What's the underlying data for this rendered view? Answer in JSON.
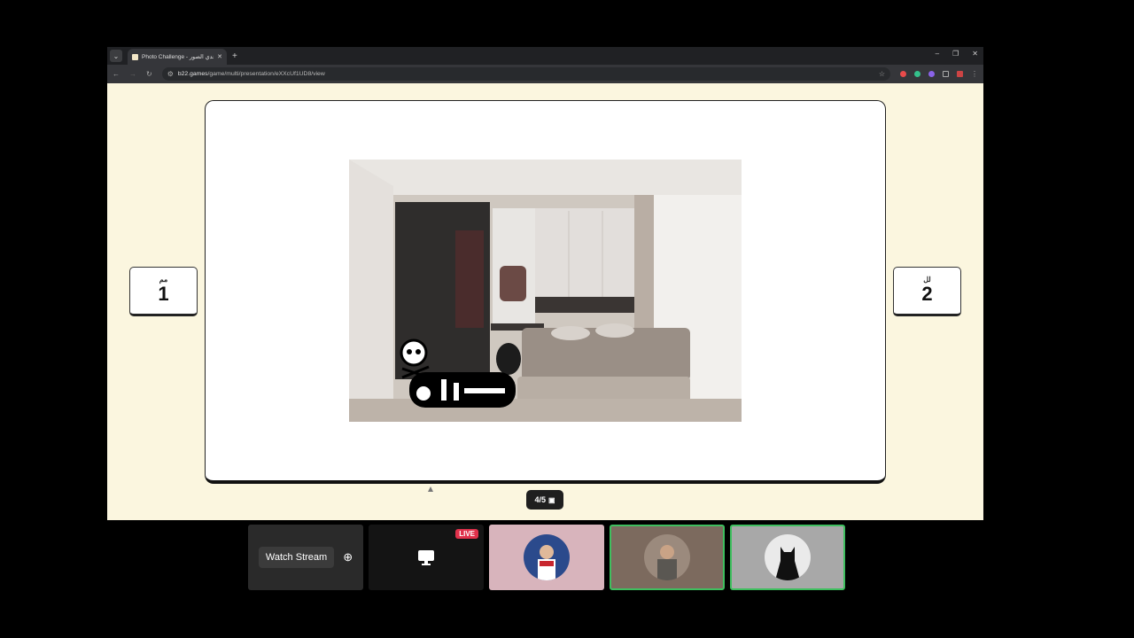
{
  "browser": {
    "tab_title": "Photo Challenge - تحدي الصور",
    "url_domain": "b22.games",
    "url_path": "/game/multi/presentation/eXXcUf1UD8/view"
  },
  "game": {
    "player_left": {
      "name": "مم",
      "score": "1"
    },
    "player_right": {
      "name": "لل",
      "score": "2"
    },
    "counter": "4/5"
  },
  "stream": {
    "watch_label": "Watch Stream",
    "live_badge": "LIVE"
  }
}
